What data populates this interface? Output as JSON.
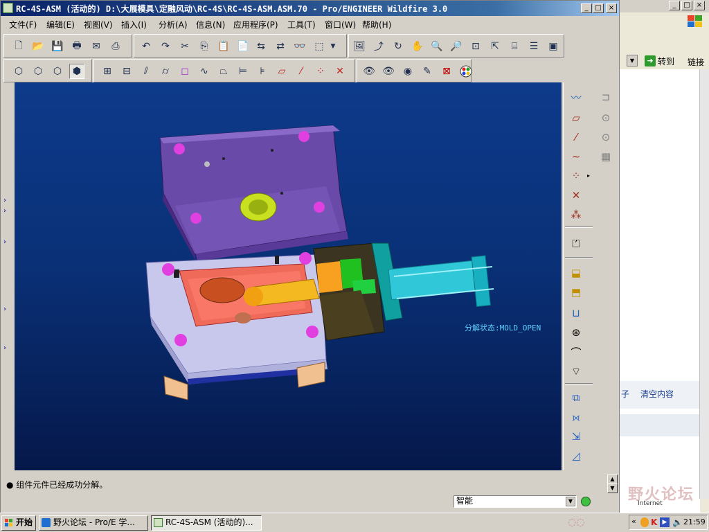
{
  "window": {
    "title": "RC-4S-ASM (活动的) D:\\大展模具\\定融风动\\RC-4S\\RC-4S-ASM.ASM.70 - Pro/ENGINEER Wildfire 3.0",
    "minimize": "_",
    "maximize": "□",
    "close": "×"
  },
  "menubar": {
    "items": [
      "文件(F)",
      "编辑(E)",
      "视图(V)",
      "插入(I)",
      "分析(A)",
      "信息(N)",
      "应用程序(P)",
      "工具(T)",
      "窗口(W)",
      "帮助(H)"
    ]
  },
  "viewport": {
    "annotation": "分解状态:MOLD_OPEN"
  },
  "message": {
    "text": "● 组件元件已经成功分解。"
  },
  "status": {
    "filter": "智能"
  },
  "background_window": {
    "goto": "转到",
    "links": "链接",
    "clear": "清空内容",
    "side_char": "子",
    "zone": "Internet",
    "watermark": "野火论坛"
  },
  "taskbar": {
    "start": "开始",
    "tasks": [
      "野火论坛 - Pro/E 学...",
      "RC-4S-ASM (活动的)..."
    ],
    "clock": "21:59"
  },
  "colors": {
    "accent": "#0a246a",
    "viewport_top": "#0d3a8a",
    "viewport_bottom": "#05184a",
    "annotation": "#5fd0ff"
  }
}
